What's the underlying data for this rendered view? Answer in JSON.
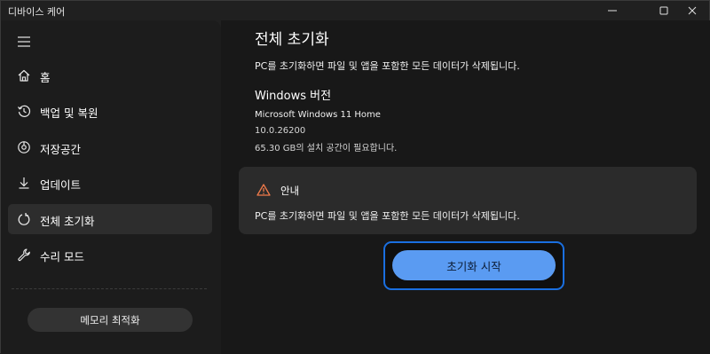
{
  "window": {
    "title": "디바이스 케어"
  },
  "sidebar": {
    "items": [
      {
        "label": "홈",
        "icon": "home-icon"
      },
      {
        "label": "백업 및 복원",
        "icon": "backup-restore-icon"
      },
      {
        "label": "저장공간",
        "icon": "storage-icon"
      },
      {
        "label": "업데이트",
        "icon": "download-icon"
      },
      {
        "label": "전체 초기화",
        "icon": "reset-icon",
        "active": true
      },
      {
        "label": "수리 모드",
        "icon": "wrench-icon"
      }
    ],
    "memory_button": "메모리 최적화"
  },
  "main": {
    "title": "전체 초기화",
    "description": "PC를 초기화하면 파일 및 앱을 포함한 모든 데이터가 삭제됩니다.",
    "version_heading": "Windows 버전",
    "os_name": "Microsoft Windows 11 Home",
    "os_version": "10.0.26200",
    "space_required": "65.30 GB의 설치 공간이 필요합니다.",
    "notice": {
      "title": "안내",
      "body": "PC를 초기화하면 파일 및 앱을 포함한 모든 데이터가 삭제됩니다.",
      "icon": "warning-icon"
    },
    "reset_button": "초기화 시작"
  },
  "colors": {
    "accent": "#5a9bf2",
    "focus_ring": "#1a6fe0",
    "warning": "#f07a4a"
  }
}
